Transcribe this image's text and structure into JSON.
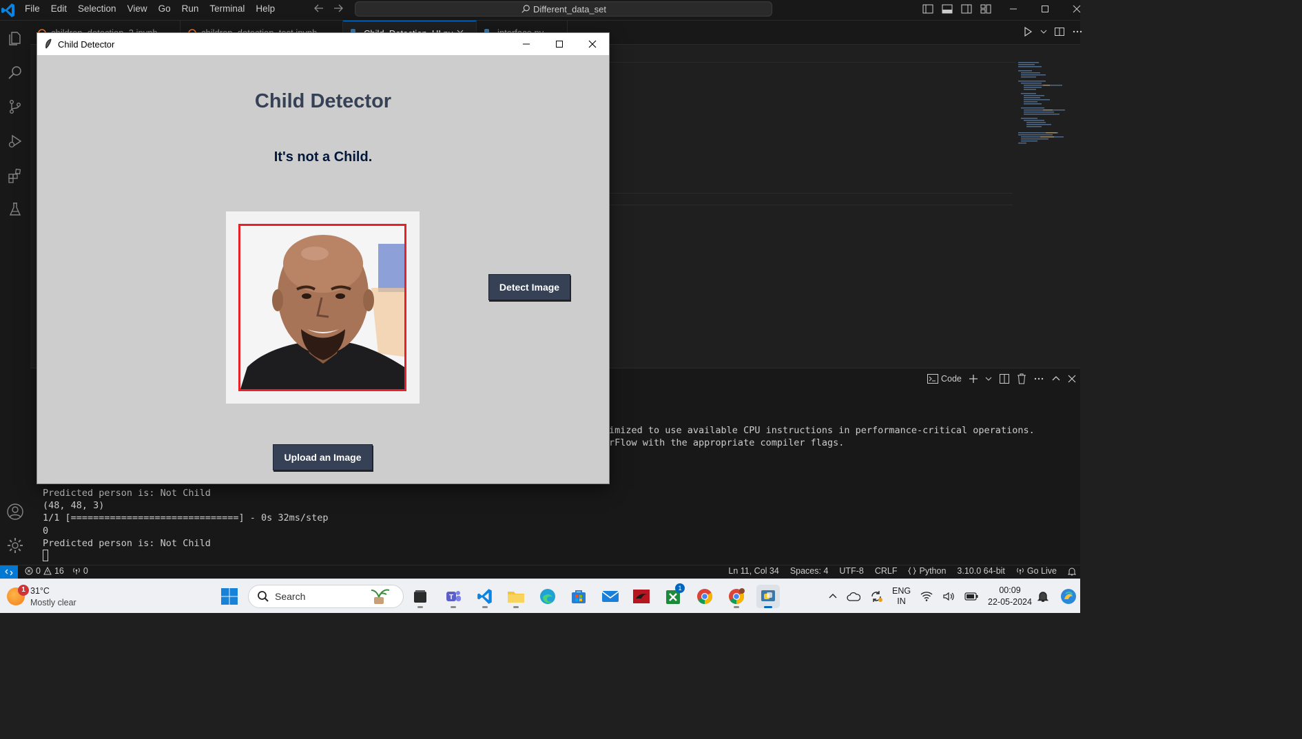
{
  "vscode": {
    "menu": [
      "File",
      "Edit",
      "Selection",
      "View",
      "Go",
      "Run",
      "Terminal",
      "Help"
    ],
    "command_center": "Different_data_set",
    "tabs": [
      {
        "label": "children_detection_2.ipynb",
        "icon": "jupyter-icon",
        "active": false
      },
      {
        "label": "children_detection_test.ipynb",
        "icon": "jupyter-icon",
        "active": false
      },
      {
        "label": "Child_Detection_UI.py",
        "icon": "python-icon",
        "active": true
      },
      {
        "label": "interface.py",
        "icon": "python-icon",
        "active": false
      }
    ],
    "panel": {
      "terminal_profile": "Code",
      "terminal_lines": [
        "imized to use available CPU instructions in performance-critical operations.",
        "rFlow with the appropriate compiler flags.",
        "Predicted person is: Not Child",
        "(48, 48, 3)",
        "1/1 [==============================] - 0s 32ms/step",
        "0",
        "Predicted person is: Not Child"
      ]
    },
    "status": {
      "errors": "0",
      "warnings": "16",
      "ports": "0",
      "position": "Ln 11, Col 34",
      "spaces": "Spaces: 4",
      "encoding": "UTF-8",
      "eol": "CRLF",
      "language": "Python",
      "interpreter": "3.10.0 64-bit",
      "golive": "Go Live"
    },
    "colors": {
      "accent": "#0078d4",
      "background": "#1f1f1f",
      "chrome": "#181818"
    }
  },
  "app_window": {
    "title": "Child Detector",
    "heading": "Child Detector",
    "result": "It's not a Child.",
    "detect_button": "Detect Image",
    "upload_button": "Upload an Image",
    "colors": {
      "button_bg": "#364156",
      "heading": "#364156",
      "result": "#011638",
      "body": "#cdcdcd",
      "image_border": "#e8202a"
    }
  },
  "taskbar": {
    "weather": {
      "temp": "31°C",
      "condition": "Mostly clear",
      "badge": "1"
    },
    "search_placeholder": "Search",
    "apps": [
      {
        "name": "file-manager-icon"
      },
      {
        "name": "teams-icon"
      },
      {
        "name": "vscode-icon"
      },
      {
        "name": "file-explorer-icon"
      },
      {
        "name": "edge-icon"
      },
      {
        "name": "ms-store-icon"
      },
      {
        "name": "mail-icon"
      },
      {
        "name": "red-app-icon"
      },
      {
        "name": "xbox-icon",
        "badge": "1"
      },
      {
        "name": "chrome-icon"
      },
      {
        "name": "chrome-profile-icon"
      },
      {
        "name": "python-app-icon"
      }
    ],
    "language": {
      "line1": "ENG",
      "line2": "IN"
    },
    "time": "00:09",
    "date": "22-05-2024"
  }
}
